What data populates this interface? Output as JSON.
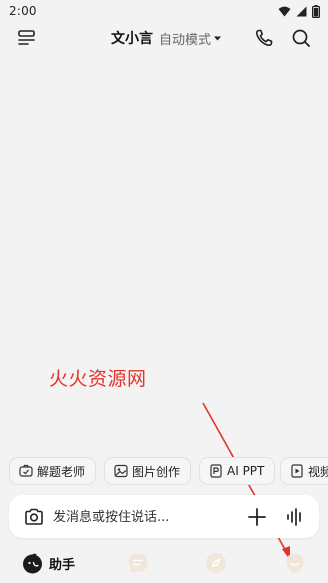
{
  "status_bar": {
    "time": "2:00",
    "icons": [
      "wifi-icon",
      "signal-icon",
      "battery-icon"
    ]
  },
  "header": {
    "title": "文小言",
    "mode": "自动模式",
    "icons": [
      "menu-icon",
      "chevron-down-icon",
      "phone-icon",
      "search-icon"
    ]
  },
  "watermark": "火火资源网",
  "quick_actions": [
    {
      "label": "解题老师",
      "icon": "camera-solve-icon"
    },
    {
      "label": "图片创作",
      "icon": "image-icon"
    },
    {
      "label": "AI PPT",
      "icon": "ppt-icon"
    },
    {
      "label": "视频",
      "icon": "video-icon"
    }
  ],
  "input_bar": {
    "placeholder": "发消息或按住说话...",
    "icons": [
      "camera-icon",
      "plus-icon",
      "voice-wave-icon"
    ]
  },
  "bottom_nav": [
    {
      "label": "助手",
      "icon": "assistant-avatar-icon",
      "active": true
    },
    {
      "label": "",
      "icon": "chat-icon",
      "active": false
    },
    {
      "label": "",
      "icon": "compass-icon",
      "active": false
    },
    {
      "label": "",
      "icon": "profile-icon",
      "active": false
    }
  ],
  "colors": {
    "background": "#f4f3f3",
    "watermark": "#e5322d",
    "arrow": "#e5322d",
    "inactive_nav": "#f1e6da"
  }
}
